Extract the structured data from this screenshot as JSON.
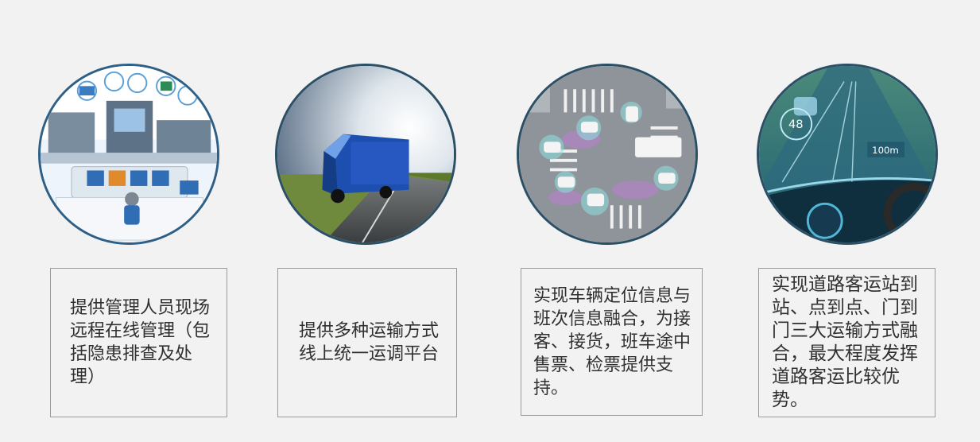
{
  "panels": [
    {
      "image": "smart-control-room-illustration",
      "caption": "提供管理人员现场远程在线管理（包括隐患排查及处理）"
    },
    {
      "image": "electric-truck-on-highway",
      "caption": "提供多种运输方式线上统一运调平台"
    },
    {
      "image": "vehicles-at-intersection",
      "caption": "实现车辆定位信息与班次信息融合，为接客、接货，班车途中售票、检票提供支持。"
    },
    {
      "image": "smart-car-dashboard-hud",
      "caption": "实现道路客运站到站、点到点、门到门三大运输方式融合，最大程度发挥道路客运比较优势。"
    }
  ],
  "hud": {
    "speed": "48",
    "distance": "100m"
  },
  "colors": {
    "accent": "#2b5066",
    "text": "#303030",
    "background": "#f2f2f2"
  }
}
